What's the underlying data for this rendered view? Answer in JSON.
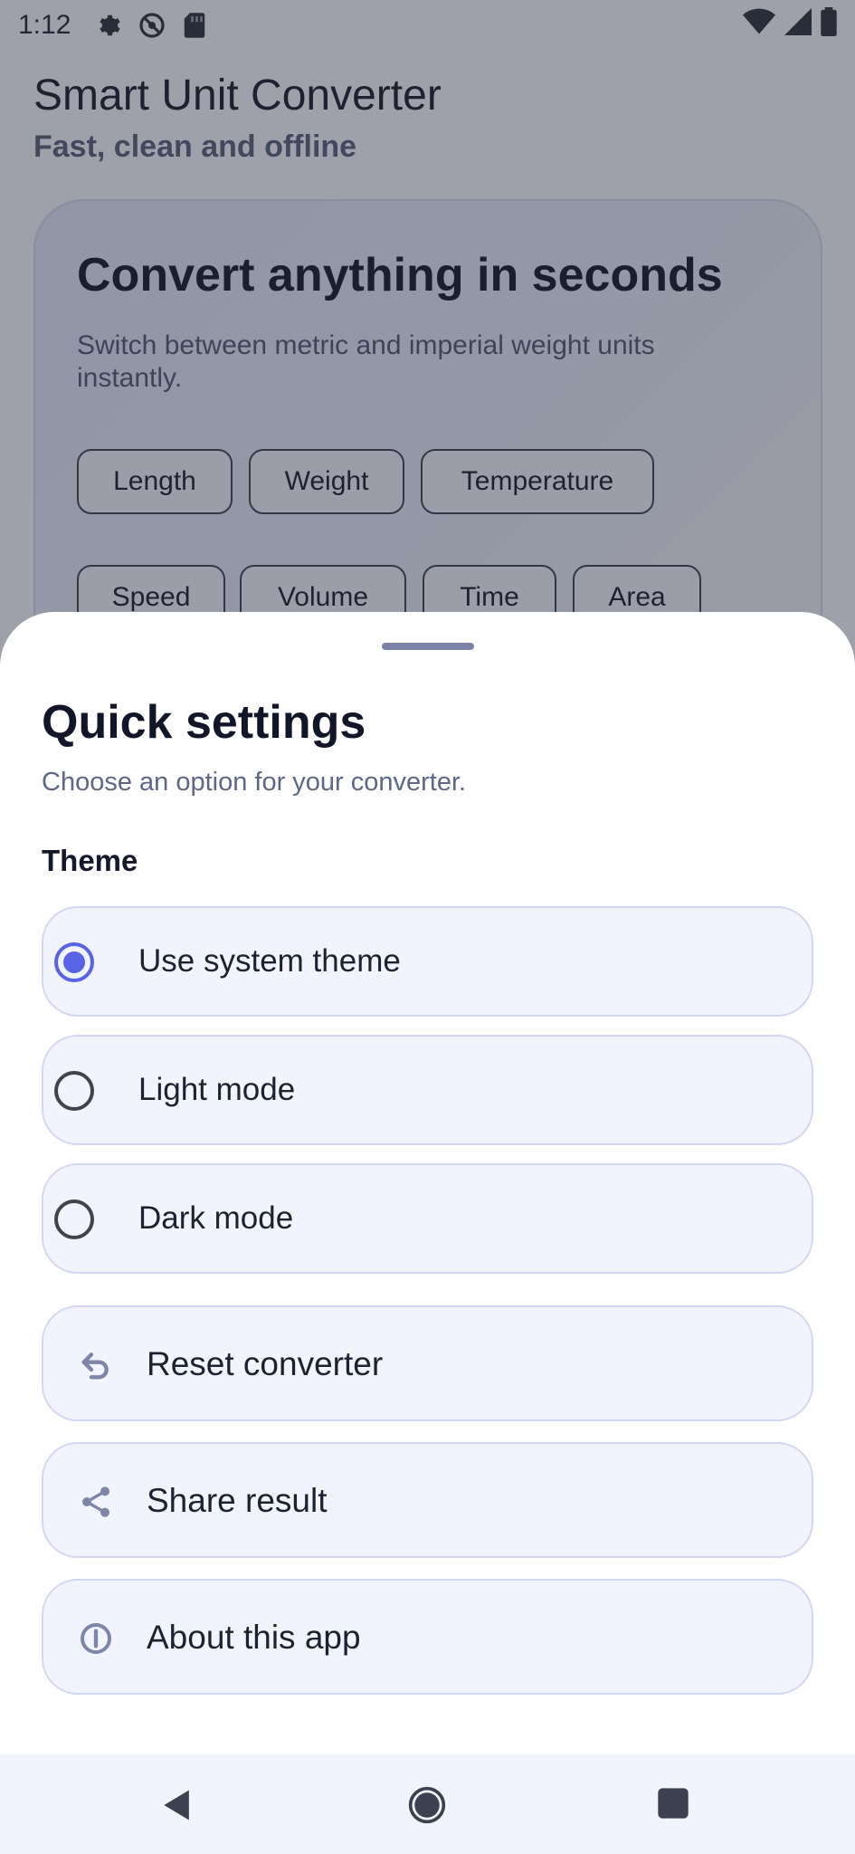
{
  "status_bar": {
    "time": "1:12",
    "icons_left": [
      "gear-icon",
      "do-not-disturb-icon",
      "sd-card-icon"
    ],
    "icons_right": [
      "wifi-icon",
      "signal-icon",
      "battery-icon"
    ]
  },
  "app": {
    "title": "Smart Unit Converter",
    "subtitle": "Fast, clean and offline",
    "hero": {
      "title": "Convert anything in seconds",
      "description": "Switch between metric and imperial weight units instantly.",
      "categories_row1": [
        "Length",
        "Weight",
        "Temperature"
      ],
      "categories_row2": [
        "Speed",
        "Volume",
        "Time",
        "Area"
      ]
    }
  },
  "sheet": {
    "title": "Quick settings",
    "subtitle": "Choose an option for your converter.",
    "theme_label": "Theme",
    "theme_options": [
      {
        "label": "Use system theme",
        "selected": true
      },
      {
        "label": "Light mode",
        "selected": false
      },
      {
        "label": "Dark mode",
        "selected": false
      }
    ],
    "actions": [
      {
        "label": "Reset converter",
        "icon": "undo-icon"
      },
      {
        "label": "Share result",
        "icon": "share-icon"
      },
      {
        "label": "About this app",
        "icon": "info-icon"
      }
    ]
  },
  "colors": {
    "accent": "#5a63e6",
    "option_bg": "#f1f4fd",
    "option_border": "#d2d8f3",
    "text_primary": "#111729",
    "text_secondary": "#5d6786"
  },
  "nav_bar": {
    "buttons": [
      "back-icon",
      "home-icon",
      "recents-icon"
    ]
  }
}
